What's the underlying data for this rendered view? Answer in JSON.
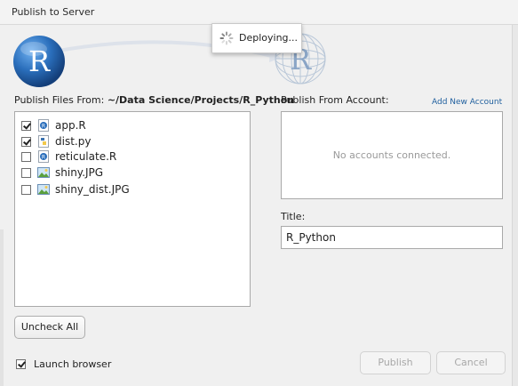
{
  "window": {
    "title": "Publish to Server"
  },
  "status": {
    "text": "Deploying..."
  },
  "files": {
    "label": "Publish Files From:",
    "path": "~/Data Science/Projects/R_Python",
    "items": [
      {
        "name": "app.R",
        "checked": true,
        "icon": "r-file-icon"
      },
      {
        "name": "dist.py",
        "checked": true,
        "icon": "python-file-icon"
      },
      {
        "name": "reticulate.R",
        "checked": false,
        "icon": "r-file-icon"
      },
      {
        "name": "shiny.JPG",
        "checked": false,
        "icon": "image-file-icon"
      },
      {
        "name": "shiny_dist.JPG",
        "checked": false,
        "icon": "image-file-icon"
      }
    ],
    "uncheck_all_label": "Uncheck All"
  },
  "account": {
    "label": "Publish From Account:",
    "add_label": "Add New Account",
    "empty_text": "No accounts connected."
  },
  "title_field": {
    "label": "Title:",
    "value": "R_Python"
  },
  "launch_browser": {
    "label": "Launch browser",
    "checked": true
  },
  "buttons": {
    "publish": "Publish",
    "cancel": "Cancel"
  },
  "colors": {
    "link": "#1f5f9e",
    "r_blue": "#2a6ebb"
  }
}
